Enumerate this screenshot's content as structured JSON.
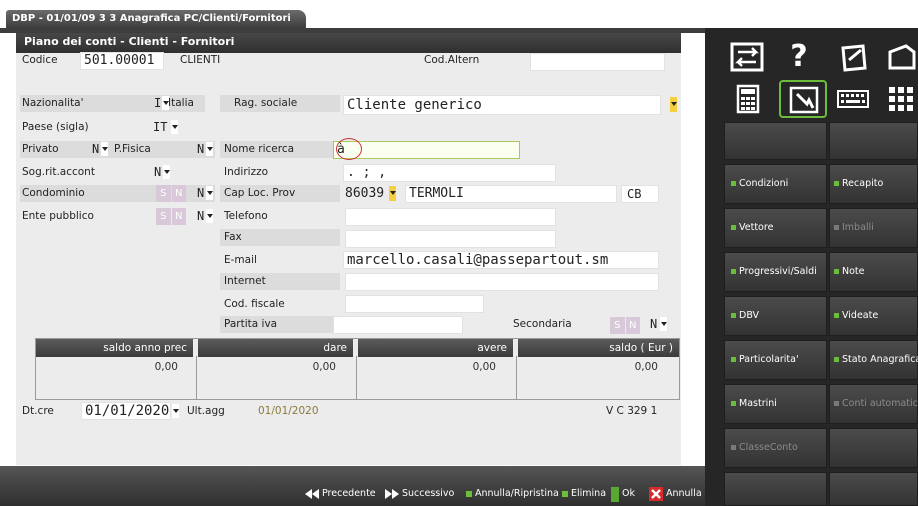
{
  "window": {
    "tab_title": "DBP - 01/01/09  3 3  Anagrafica PC/Clienti/Fornitori"
  },
  "form": {
    "heading": "Piano dei conti - Clienti - Fornitori",
    "codice_label": "Codice",
    "codice_value": "501.00001",
    "codice_type": "CLIENTI",
    "cod_altern_label": "Cod.Altern",
    "cod_altern_value": "",
    "nazionalita_label": "Nazionalita'",
    "nazionalita_code": "I",
    "nazionalita_value": "Italia",
    "paese_label": "Paese (sigla)",
    "paese_value": "IT",
    "privato_label": "Privato",
    "privato_value": "N",
    "pfisica_label": "P.Fisica",
    "pfisica_value": "N",
    "sog_rit_label": "Sog.rit.accont",
    "sog_rit_value": "N",
    "condominio_label": "Condominio",
    "condominio_s": "S",
    "condominio_n": "N",
    "condominio_value": "N",
    "ente_label": "Ente pubblico",
    "ente_s": "S",
    "ente_n": "N",
    "ente_value": "N",
    "rag_sociale_label": "Rag. sociale",
    "rag_sociale_value": "Cliente generico",
    "nome_ricerca_label": "Nome ricerca",
    "nome_ricerca_value": "à",
    "indirizzo_label": "Indirizzo",
    "indirizzo_value": ". ; ,",
    "cap_label": "Cap Loc. Prov",
    "cap_value": "86039",
    "localita_value": "TERMOLI",
    "provincia_value": "CB",
    "telefono_label": "Telefono",
    "telefono_value": "",
    "fax_label": "Fax",
    "fax_value": "",
    "email_label": "E-mail",
    "email_value": "marcello.casali@passepartout.sm",
    "internet_label": "Internet",
    "internet_value": "",
    "cod_fiscale_label": "Cod. fiscale",
    "cod_fiscale_value": "",
    "partita_iva_label": "Partita iva",
    "partita_iva_value": "",
    "secondaria_label": "Secondaria",
    "secondaria_s": "S",
    "secondaria_n": "N",
    "secondaria_value": "N",
    "dt_cre_label": "Dt.cre",
    "dt_cre_value": "01/01/2020",
    "ult_agg_label": "Ult.agg",
    "ult_agg_value": "01/01/2020",
    "version_value": "V C 329 1"
  },
  "saldi": {
    "headers": [
      "saldo anno prec",
      "dare",
      "avere",
      "saldo ( Eur )"
    ],
    "values": [
      "0,00",
      "0,00",
      "0,00",
      "0,00"
    ]
  },
  "bottom_bar": {
    "precedente": "Precedente",
    "successivo": "Successivo",
    "annulla_ripristina": "Annulla/Ripristina",
    "elimina": "Elimina",
    "ok": "Ok",
    "annulla": "Annulla"
  },
  "right_panel": {
    "icons": [
      "expand-icon",
      "help-icon",
      "notepad-icon",
      "printer-icon",
      "calculator-icon",
      "hand-pointer-icon",
      "keyboard-icon",
      "grid-icon"
    ],
    "help_glyph": "?",
    "buttons": {
      "condizioni": "Condizioni",
      "recapito": "Recapito",
      "vettore": "Vettore",
      "imballi": "Imballi",
      "progressivi_saldi": "Progressivi/Saldi",
      "note": "Note",
      "dbv": "DBV",
      "videate": "Videate",
      "particolarita": "Particolarita'",
      "stato_anagrafica": "Stato Anagrafica",
      "mastrini": "Mastrini",
      "conti_automatici": "Conti automatici",
      "classe_conto": "ClasseConto"
    }
  },
  "colors": {
    "accent_green": "#6cbd3c",
    "dropdown_yellow": "#f4d03f",
    "panel_dark": "#262626",
    "cancel_red": "#d62b2b"
  }
}
